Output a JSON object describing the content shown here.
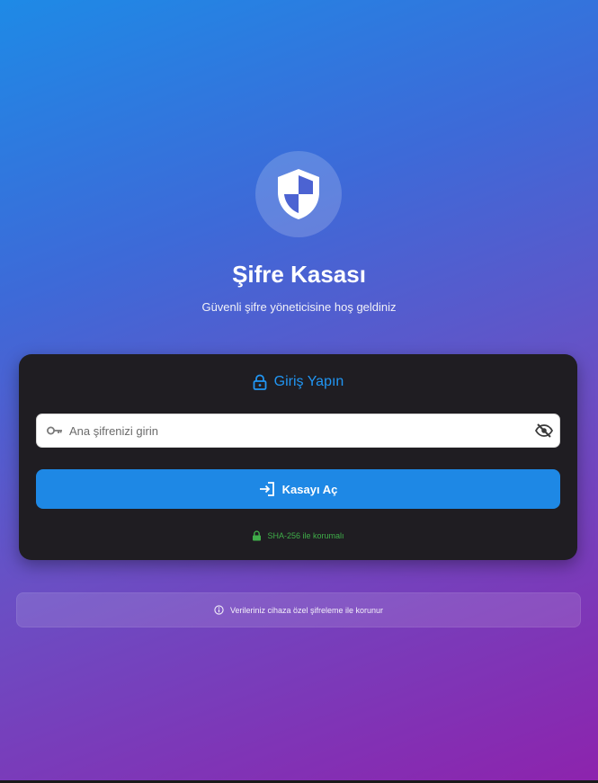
{
  "app": {
    "title": "Şifre Kasası",
    "subtitle": "Güvenli şifre yöneticisine hoş geldiniz"
  },
  "login_card": {
    "heading": "Giriş Yapın",
    "password_placeholder": "Ana şifrenizi girin",
    "password_value": "",
    "open_button_label": "Kasayı Aç",
    "security_note": "SHA-256 ile korumalı"
  },
  "info_banner": {
    "text": "Verileriniz cihaza özel şifreleme ile korunur"
  },
  "icons": {
    "logo": "shield-icon",
    "heading": "lock-icon",
    "field_prefix": "key-icon",
    "field_suffix": "visibility-off-icon",
    "button": "login-icon",
    "security_note": "lock-icon",
    "info": "info-icon"
  },
  "colors": {
    "gradient_start": "#1e8ae6",
    "gradient_end": "#8d23ad",
    "card_background": "#1f1d22",
    "accent": "#1e88e5",
    "heading": "#2196f3",
    "secure_green": "#3fae49"
  }
}
